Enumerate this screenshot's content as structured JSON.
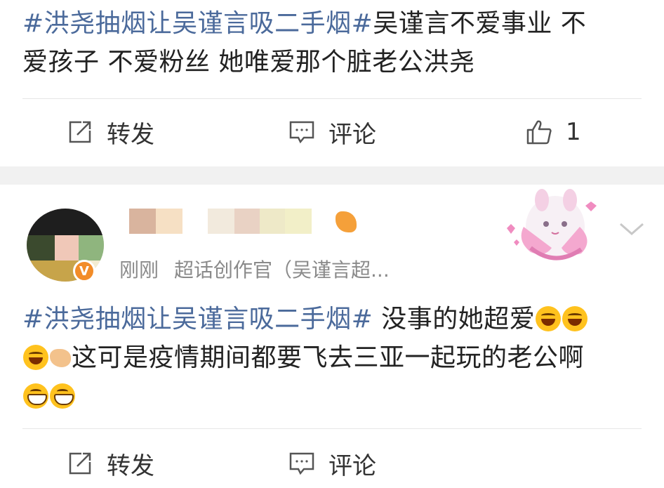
{
  "post1": {
    "tag": "#洪尧抽烟让吴谨言吸二手烟#",
    "text_a": "吴谨言不爱事业 不",
    "text_b": "爱孩子 不爱粉丝 她唯爱那个脏老公洪尧",
    "actions": {
      "repost": "转发",
      "comment": "评论",
      "like_count": "1"
    }
  },
  "post2": {
    "user": {
      "badge_letter": "V",
      "time": "刚刚",
      "source": "超话创作官（吴谨言超..."
    },
    "tag": "#洪尧抽烟让吴谨言吸二手烟#",
    "text_a": " 没事的她超爱",
    "text_b": "这可是疫情期间都要飞去三亚一起玩的老公啊",
    "actions": {
      "repost": "转发",
      "comment": "评论"
    }
  },
  "icons": {
    "repost": "repost-icon",
    "comment": "comment-icon",
    "like": "thumbs-up-icon",
    "more": "chevron-down-icon",
    "laugh_emoji": "laugh-cry-emoji-icon",
    "grin_emoji": "grin-emoji-icon",
    "hand_emoji": "pointing-hand-emoji-icon"
  },
  "colors": {
    "tag": "#4b6a9b",
    "text": "#222222",
    "meta": "#8a8a8a",
    "separator": "#f1f1f1",
    "badge": "#f28c28"
  }
}
